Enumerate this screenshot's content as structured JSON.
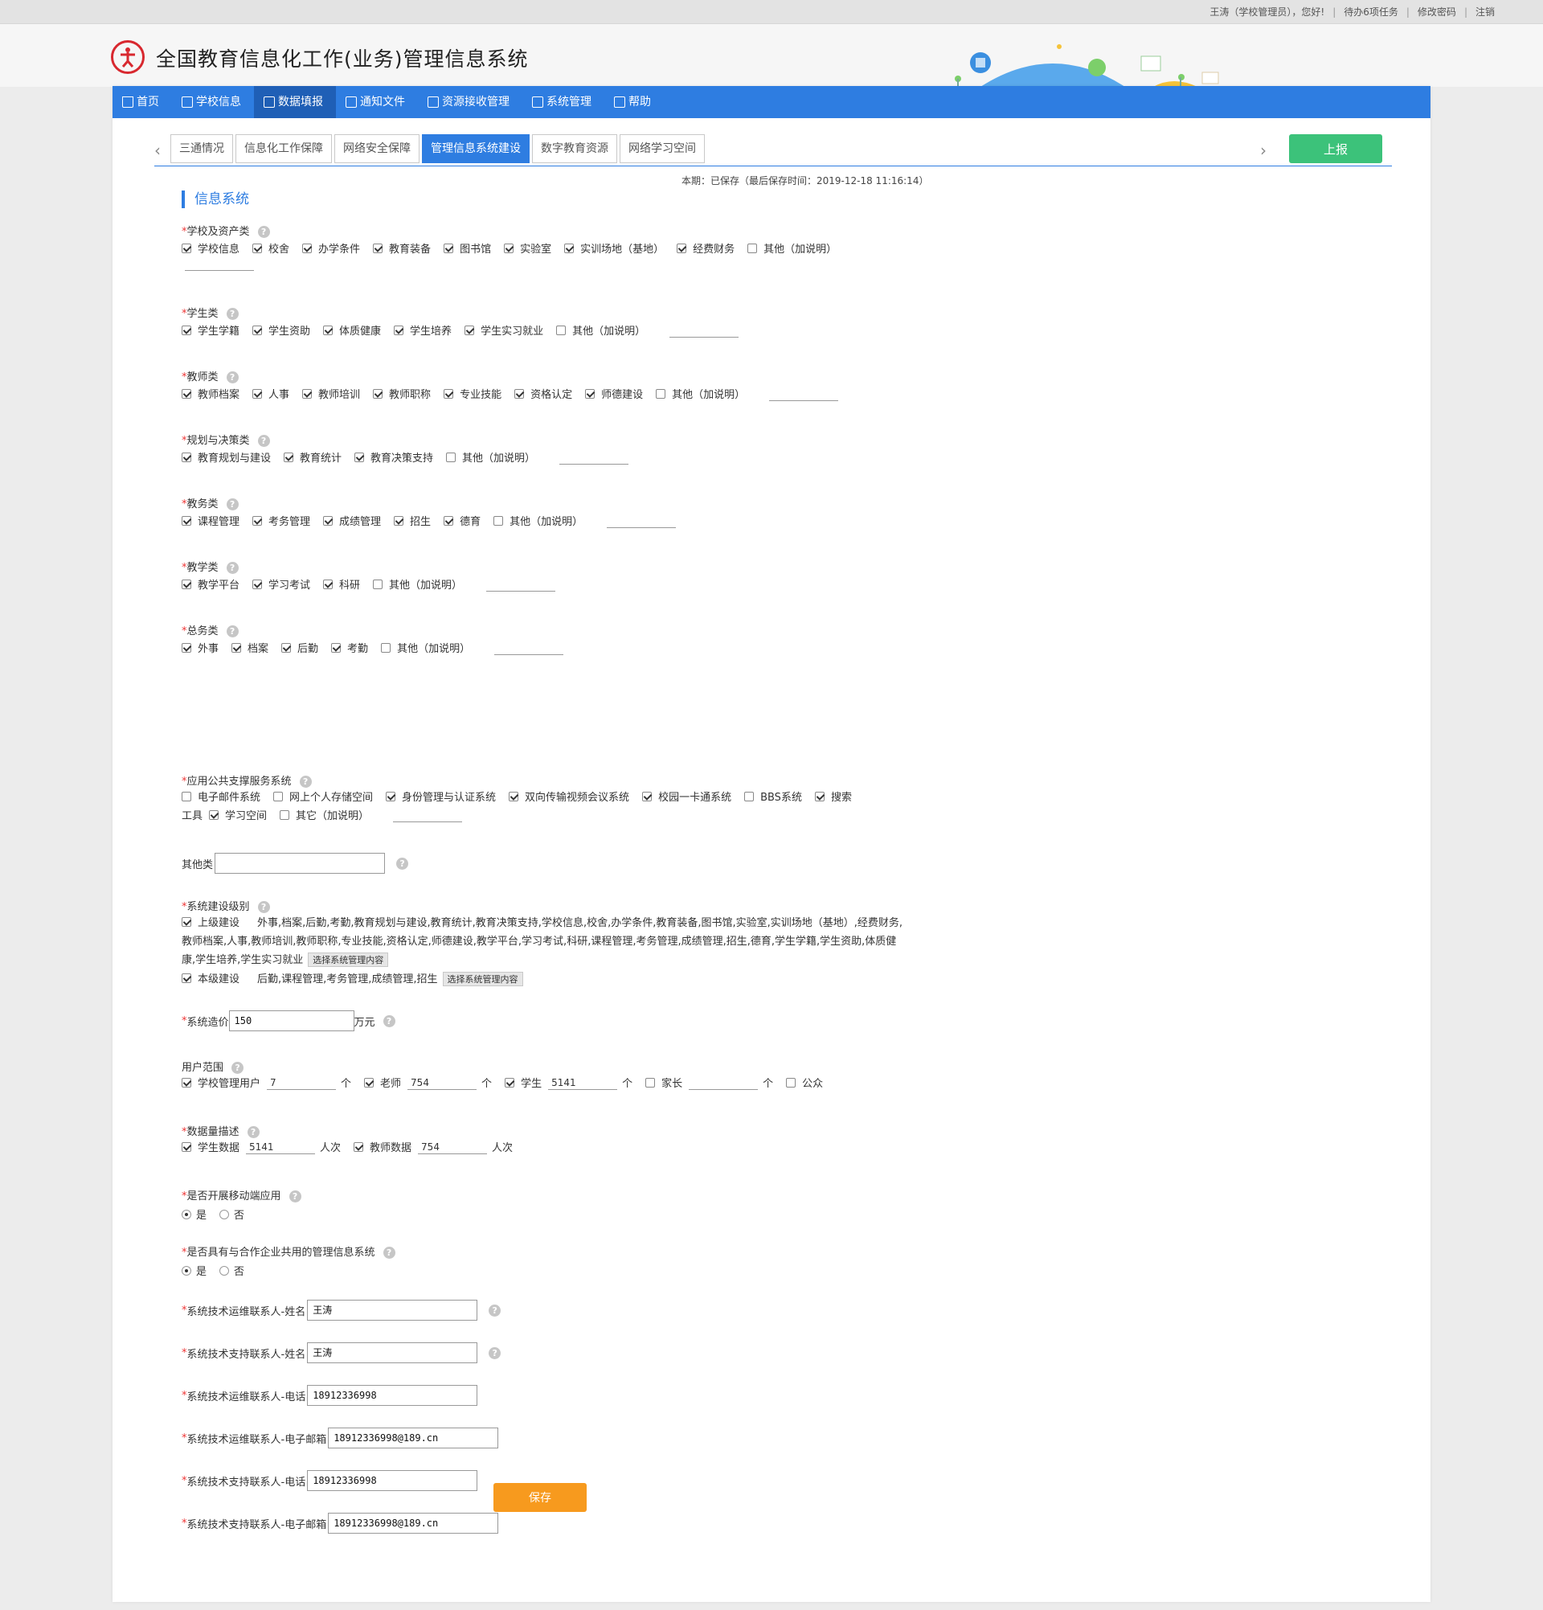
{
  "topbar": {
    "greeting": "王涛（学校管理员），您好!",
    "tasks": "待办6项任务",
    "change_password": "修改密码",
    "logout": "注销"
  },
  "site_title": "全国教育信息化工作(业务)管理信息系统",
  "nav": [
    {
      "label": "首页",
      "icon": "home-icon"
    },
    {
      "label": "学校信息",
      "icon": "document-icon"
    },
    {
      "label": "数据填报",
      "icon": "edit-icon"
    },
    {
      "label": "通知文件",
      "icon": "mail-icon"
    },
    {
      "label": "资源接收管理",
      "icon": "inbox-icon"
    },
    {
      "label": "系统管理",
      "icon": "settings-icon"
    },
    {
      "label": "帮助",
      "icon": "grid-icon"
    }
  ],
  "tabs": [
    "三通情况",
    "信息化工作保障",
    "网络安全保障",
    "管理信息系统建设",
    "数字教育资源",
    "网络学习空间"
  ],
  "report_button": "上报",
  "save_status": "本期：已保存（最后保存时间：2019-12-18 11:16:14）",
  "section_title": "信息系统",
  "groups": [
    {
      "label": "学校及资产类",
      "options": [
        [
          "学校信息",
          true
        ],
        [
          "校舍",
          true
        ],
        [
          "办学条件",
          true
        ],
        [
          "教育装备",
          true
        ],
        [
          "图书馆",
          true
        ],
        [
          "实验室",
          true
        ],
        [
          "实训场地（基地）",
          true
        ],
        [
          "经费财务",
          true
        ],
        [
          "其他（加说明）",
          false
        ]
      ]
    },
    {
      "label": "学生类",
      "options": [
        [
          "学生学籍",
          true
        ],
        [
          "学生资助",
          true
        ],
        [
          "体质健康",
          true
        ],
        [
          "学生培养",
          true
        ],
        [
          "学生实习就业",
          true
        ],
        [
          "其他（加说明）",
          false
        ]
      ]
    },
    {
      "label": "教师类",
      "options": [
        [
          "教师档案",
          true
        ],
        [
          "人事",
          true
        ],
        [
          "教师培训",
          true
        ],
        [
          "教师职称",
          true
        ],
        [
          "专业技能",
          true
        ],
        [
          "资格认定",
          true
        ],
        [
          "师德建设",
          true
        ],
        [
          "其他（加说明）",
          false
        ]
      ]
    },
    {
      "label": "规划与决策类",
      "options": [
        [
          "教育规划与建设",
          true
        ],
        [
          "教育统计",
          true
        ],
        [
          "教育决策支持",
          true
        ],
        [
          "其他（加说明）",
          false
        ]
      ]
    },
    {
      "label": "教务类",
      "options": [
        [
          "课程管理",
          true
        ],
        [
          "考务管理",
          true
        ],
        [
          "成绩管理",
          true
        ],
        [
          "招生",
          true
        ],
        [
          "德育",
          true
        ],
        [
          "其他（加说明）",
          false
        ]
      ]
    },
    {
      "label": "教学类",
      "options": [
        [
          "教学平台",
          true
        ],
        [
          "学习考试",
          true
        ],
        [
          "科研",
          true
        ],
        [
          "其他（加说明）",
          false
        ]
      ]
    },
    {
      "label": "总务类",
      "options": [
        [
          "外事",
          true
        ],
        [
          "档案",
          true
        ],
        [
          "后勤",
          true
        ],
        [
          "考勤",
          true
        ],
        [
          "其他（加说明）",
          false
        ]
      ]
    }
  ],
  "public_service": {
    "label": "应用公共支撑服务系统",
    "line1": [
      [
        "电子邮件系统",
        false
      ],
      [
        "网上个人存储空间",
        false
      ],
      [
        "身份管理与认证系统",
        true
      ],
      [
        "双向传输视频会议系统",
        true
      ],
      [
        "校园一卡通系统",
        true
      ],
      [
        "BBS系统",
        false
      ],
      [
        "搜索",
        true
      ]
    ],
    "line2_prefix": "工具",
    "line2": [
      [
        "学习空间",
        true
      ],
      [
        "其它（加说明）",
        false
      ]
    ]
  },
  "other_class": {
    "label": "其他类",
    "value": ""
  },
  "build_level": {
    "label": "系统建设级别",
    "upper": {
      "label": "上级建设",
      "checked": true,
      "content": "外事,档案,后勤,考勤,教育规划与建设,教育统计,教育决策支持,学校信息,校舍,办学条件,教育装备,图书馆,实验室,实训场地（基地）,经费财务,教师档案,人事,教师培训,教师职称,专业技能,资格认定,师德建设,教学平台,学习考试,科研,课程管理,考务管理,成绩管理,招生,德育,学生学籍,学生资助,体质健康,学生培养,学生实习就业",
      "button": "选择系统管理内容"
    },
    "local": {
      "label": "本级建设",
      "checked": true,
      "content": "后勤,课程管理,考务管理,成绩管理,招生",
      "button": "选择系统管理内容"
    }
  },
  "cost": {
    "label": "系统造价",
    "value": "150",
    "unit": "万元"
  },
  "user_scope": {
    "label": "用户范围",
    "items": [
      {
        "label": "学校管理用户",
        "checked": true,
        "value": "7",
        "unit": "个"
      },
      {
        "label": "老师",
        "checked": true,
        "value": "754",
        "unit": "个"
      },
      {
        "label": "学生",
        "checked": true,
        "value": "5141",
        "unit": "个"
      },
      {
        "label": "家长",
        "checked": false,
        "value": "",
        "unit": "个"
      },
      {
        "label": "公众",
        "checked": false
      }
    ]
  },
  "data_volume": {
    "label": "数据量描述",
    "items": [
      {
        "label": "学生数据",
        "checked": true,
        "value": "5141",
        "unit": "人次"
      },
      {
        "label": "教师数据",
        "checked": true,
        "value": "754",
        "unit": "人次"
      }
    ]
  },
  "mobile": {
    "label": "是否开展移动端应用",
    "yes": "是",
    "no": "否",
    "selected": "是"
  },
  "shared": {
    "label": "是否具有与合作企业共用的管理信息系统",
    "yes": "是",
    "no": "否",
    "selected": "是"
  },
  "contacts": [
    {
      "label": "系统技术运维联系人-姓名",
      "value": "王涛",
      "help": true
    },
    {
      "label": "系统技术支持联系人-姓名",
      "value": "王涛",
      "help": true
    },
    {
      "label": "系统技术运维联系人-电话",
      "value": "18912336998",
      "help": false
    },
    {
      "label": "系统技术运维联系人-电子邮箱",
      "value": "18912336998@189.cn",
      "help": false
    },
    {
      "label": "系统技术支持联系人-电话",
      "value": "18912336998",
      "help": false
    },
    {
      "label": "系统技术支持联系人-电子邮箱",
      "value": "18912336998@189.cn",
      "help": false
    }
  ],
  "save_button": "保存",
  "colors": {
    "nav": "#2e7de1",
    "nav_active": "#1f5fb6",
    "report": "#3cc27a",
    "save": "#f79a1e",
    "required": "#e33"
  }
}
